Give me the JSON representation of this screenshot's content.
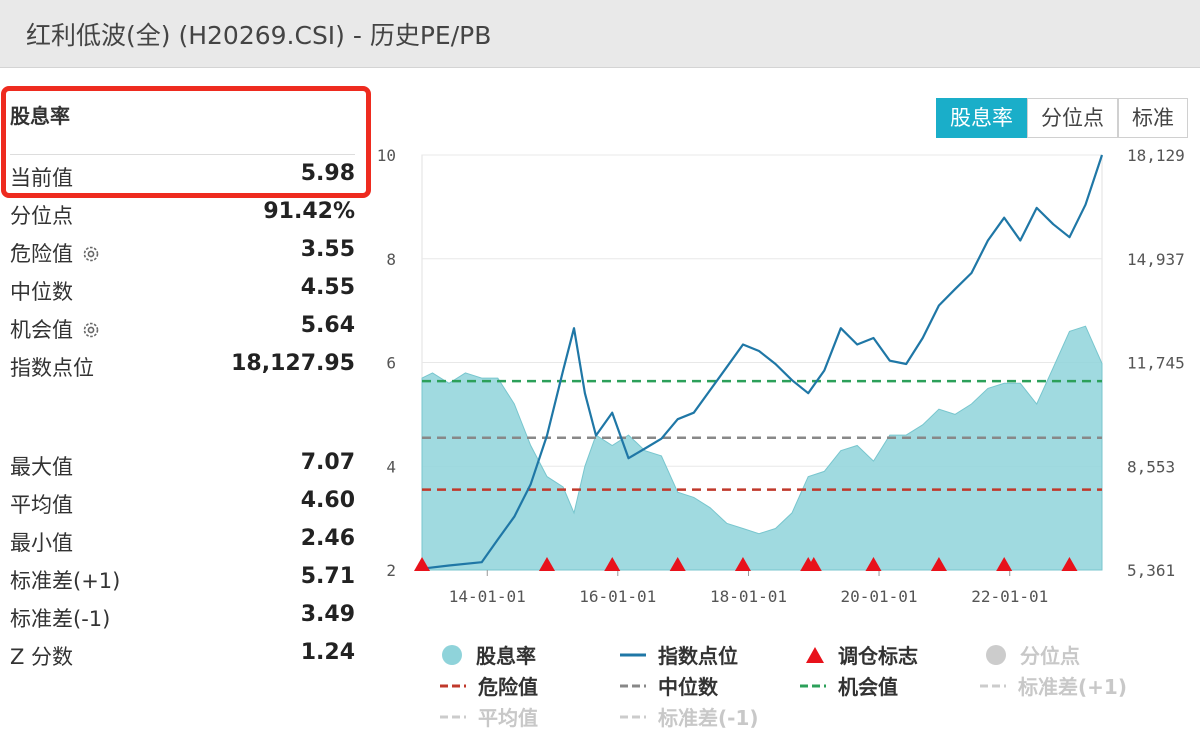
{
  "header": {
    "title": "红利低波(全) (H20269.CSI) - 历史PE/PB"
  },
  "panel": {
    "section_title": "股息率",
    "current": {
      "label": "当前值",
      "value": "5.98"
    },
    "stats_top": [
      {
        "label": "分位点",
        "value": "91.42%"
      },
      {
        "label": "危险值",
        "value": "3.55",
        "gear": true
      },
      {
        "label": "中位数",
        "value": "4.55"
      },
      {
        "label": "机会值",
        "value": "5.64",
        "gear": true
      },
      {
        "label": "指数点位",
        "value": "18,127.95"
      }
    ],
    "stats_bottom": [
      {
        "label": "最大值",
        "value": "7.07"
      },
      {
        "label": "平均值",
        "value": "4.60"
      },
      {
        "label": "最小值",
        "value": "2.46"
      },
      {
        "label": "标准差(+1)",
        "value": "5.71"
      },
      {
        "label": "标准差(-1)",
        "value": "3.49"
      },
      {
        "label": "Z 分数",
        "value": "1.24"
      }
    ]
  },
  "tabs": [
    {
      "label": "股息率",
      "active": true
    },
    {
      "label": "分位点",
      "active": false
    },
    {
      "label": "标准",
      "active": false
    }
  ],
  "chart_data": {
    "type": "area",
    "x_start": "2013-01-01",
    "x_end": "2023-06-01",
    "xticks": [
      "14-01-01",
      "16-01-01",
      "18-01-01",
      "20-01-01",
      "22-01-01"
    ],
    "ylim_left": [
      2,
      10
    ],
    "yticks_left": [
      "2",
      "4",
      "6",
      "8",
      "10"
    ],
    "ylim_right": [
      5361,
      18129
    ],
    "yticks_right": [
      "5,361",
      "8,553",
      "11,745",
      "14,937",
      "18,129"
    ],
    "reference_lines": [
      {
        "name": "危险值",
        "value": 3.55,
        "color": "#c0392b"
      },
      {
        "name": "中位数",
        "value": 4.55,
        "color": "#888888"
      },
      {
        "name": "机会值",
        "value": 5.64,
        "color": "#2ca05a"
      }
    ],
    "series": [
      {
        "name": "股息率",
        "color": "#8fd3da",
        "points": [
          [
            "2013-01-01",
            5.7
          ],
          [
            "2013-03-01",
            5.8
          ],
          [
            "2013-06-01",
            5.6
          ],
          [
            "2013-09-01",
            5.8
          ],
          [
            "2013-12-01",
            5.7
          ],
          [
            "2014-03-01",
            5.7
          ],
          [
            "2014-06-01",
            5.2
          ],
          [
            "2014-09-01",
            4.4
          ],
          [
            "2014-12-01",
            3.8
          ],
          [
            "2015-03-01",
            3.6
          ],
          [
            "2015-05-01",
            3.1
          ],
          [
            "2015-07-01",
            4.0
          ],
          [
            "2015-09-01",
            4.6
          ],
          [
            "2015-12-01",
            4.4
          ],
          [
            "2016-03-01",
            4.6
          ],
          [
            "2016-06-01",
            4.3
          ],
          [
            "2016-09-01",
            4.2
          ],
          [
            "2016-12-01",
            3.5
          ],
          [
            "2017-03-01",
            3.4
          ],
          [
            "2017-06-01",
            3.2
          ],
          [
            "2017-09-01",
            2.9
          ],
          [
            "2017-12-01",
            2.8
          ],
          [
            "2018-03-01",
            2.7
          ],
          [
            "2018-06-01",
            2.8
          ],
          [
            "2018-09-01",
            3.1
          ],
          [
            "2018-12-01",
            3.8
          ],
          [
            "2019-03-01",
            3.9
          ],
          [
            "2019-06-01",
            4.3
          ],
          [
            "2019-09-01",
            4.4
          ],
          [
            "2019-12-01",
            4.1
          ],
          [
            "2020-03-01",
            4.6
          ],
          [
            "2020-06-01",
            4.6
          ],
          [
            "2020-09-01",
            4.8
          ],
          [
            "2020-12-01",
            5.1
          ],
          [
            "2021-03-01",
            5.0
          ],
          [
            "2021-06-01",
            5.2
          ],
          [
            "2021-09-01",
            5.5
          ],
          [
            "2021-12-01",
            5.6
          ],
          [
            "2022-03-01",
            5.6
          ],
          [
            "2022-06-01",
            5.2
          ],
          [
            "2022-09-01",
            5.9
          ],
          [
            "2022-12-01",
            6.6
          ],
          [
            "2023-03-01",
            6.7
          ],
          [
            "2023-06-01",
            5.98
          ]
        ]
      },
      {
        "name": "指数点位",
        "axis": "right",
        "color": "#1f77a6",
        "points": [
          [
            "2013-01-01",
            5400
          ],
          [
            "2013-06-01",
            5500
          ],
          [
            "2013-12-01",
            5600
          ],
          [
            "2014-03-01",
            6300
          ],
          [
            "2014-06-01",
            7000
          ],
          [
            "2014-09-01",
            8000
          ],
          [
            "2014-12-01",
            9500
          ],
          [
            "2015-03-01",
            11500
          ],
          [
            "2015-05-01",
            12800
          ],
          [
            "2015-07-01",
            10800
          ],
          [
            "2015-09-01",
            9500
          ],
          [
            "2015-12-01",
            10200
          ],
          [
            "2016-03-01",
            8800
          ],
          [
            "2016-06-01",
            9100
          ],
          [
            "2016-09-01",
            9400
          ],
          [
            "2016-12-01",
            10000
          ],
          [
            "2017-03-01",
            10200
          ],
          [
            "2017-06-01",
            10900
          ],
          [
            "2017-09-01",
            11600
          ],
          [
            "2017-12-01",
            12300
          ],
          [
            "2018-03-01",
            12100
          ],
          [
            "2018-06-01",
            11700
          ],
          [
            "2018-09-01",
            11200
          ],
          [
            "2018-12-01",
            10800
          ],
          [
            "2019-03-01",
            11500
          ],
          [
            "2019-06-01",
            12800
          ],
          [
            "2019-09-01",
            12300
          ],
          [
            "2019-12-01",
            12500
          ],
          [
            "2020-03-01",
            11800
          ],
          [
            "2020-06-01",
            11700
          ],
          [
            "2020-09-01",
            12500
          ],
          [
            "2020-12-01",
            13500
          ],
          [
            "2021-03-01",
            14000
          ],
          [
            "2021-06-01",
            14500
          ],
          [
            "2021-09-01",
            15500
          ],
          [
            "2021-12-01",
            16200
          ],
          [
            "2022-03-01",
            15500
          ],
          [
            "2022-06-01",
            16500
          ],
          [
            "2022-09-01",
            16000
          ],
          [
            "2022-12-01",
            15600
          ],
          [
            "2023-03-01",
            16600
          ],
          [
            "2023-06-01",
            18128
          ]
        ]
      }
    ],
    "rebalance_markers": [
      "2013-01-01",
      "2014-12-01",
      "2015-12-01",
      "2016-12-01",
      "2017-12-01",
      "2018-12-01",
      "2019-01-01",
      "2019-12-01",
      "2020-12-01",
      "2021-12-01",
      "2022-12-01"
    ],
    "legend": {
      "placement": "bottom",
      "items": [
        {
          "label": "股息率",
          "kind": "circle",
          "color": "#8fd3da",
          "enabled": true
        },
        {
          "label": "指数点位",
          "kind": "line",
          "color": "#1f77a6",
          "enabled": true
        },
        {
          "label": "调仓标志",
          "kind": "triangle",
          "color": "#e8121b",
          "enabled": true
        },
        {
          "label": "分位点",
          "kind": "circle",
          "color": "#cccccc",
          "enabled": false
        },
        {
          "label": "危险值",
          "kind": "dash",
          "color": "#c0392b",
          "enabled": true
        },
        {
          "label": "中位数",
          "kind": "dash",
          "color": "#888888",
          "enabled": true
        },
        {
          "label": "机会值",
          "kind": "dash",
          "color": "#2ca05a",
          "enabled": true
        },
        {
          "label": "标准差(+1)",
          "kind": "dash",
          "color": "#cccccc",
          "enabled": false
        },
        {
          "label": "平均值",
          "kind": "dash",
          "color": "#cccccc",
          "enabled": false
        },
        {
          "label": "标准差(-1)",
          "kind": "dash",
          "color": "#cccccc",
          "enabled": false
        }
      ]
    }
  }
}
